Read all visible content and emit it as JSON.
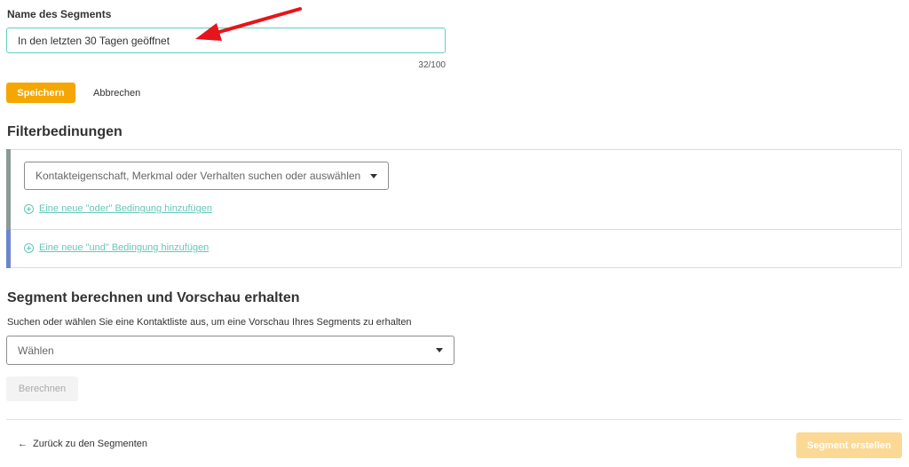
{
  "form": {
    "name_label": "Name des Segments",
    "name_value": "In den letzten 30 Tagen geöffnet",
    "counter": "32/100",
    "save_label": "Speichern",
    "cancel_label": "Abbrechen"
  },
  "filter": {
    "title": "Filterbedinungen",
    "select_placeholder": "Kontakteigenschaft, Merkmal oder Verhalten suchen oder auswählen",
    "add_or_label": "Eine neue \"oder\" Bedingung hinzufügen",
    "add_and_label": "Eine neue \"und\" Bedingung hinzufügen"
  },
  "preview": {
    "title": "Segment berechnen und Vorschau erhalten",
    "subtitle": "Suchen oder wählen Sie eine Kontaktliste aus, um eine Vorschau Ihres Segments zu erhalten",
    "select_placeholder": "Wählen",
    "compute_label": "Berechnen"
  },
  "footer": {
    "back_arrow": "←",
    "back_label": "Zurück zu den Segmenten",
    "create_label": "Segment erstellen"
  },
  "colors": {
    "primary": "#f6a600",
    "primary_disabled": "#fbd894",
    "input_focus_border": "#5fd0bf",
    "link": "#66c7b9",
    "or_stripe": "#8a9a96",
    "and_stripe": "#6b86cc",
    "annotation_arrow": "#e8141b"
  },
  "icons": {
    "annotation": "red-arrow-icon",
    "add": "plus-circle-icon",
    "dropdown": "caret-down-icon",
    "back": "left-arrow-icon"
  }
}
